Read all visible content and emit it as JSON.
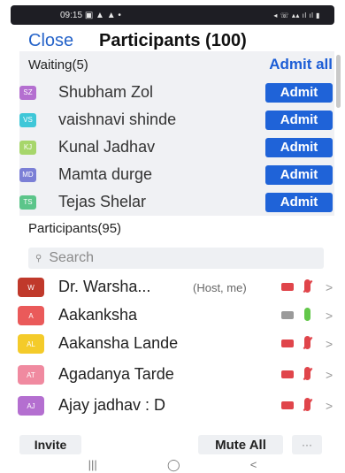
{
  "status_bar": {
    "time": "09:15",
    "left_icons": "▣ ▲ ▲ •",
    "right_icons": "◂ ☏ ▴▴ ıl ıl ▮"
  },
  "header": {
    "close_label": "Close",
    "title": "Participants (100)"
  },
  "waiting": {
    "label": "Waiting(5)",
    "admit_all_label": "Admit all",
    "rows": [
      {
        "initials": "SZ",
        "name": "Shubham Zol",
        "color": "#b46fd0",
        "admit_label": "Admit"
      },
      {
        "initials": "VS",
        "name": "vaishnavi shinde",
        "color": "#3fc7d8",
        "admit_label": "Admit"
      },
      {
        "initials": "KJ",
        "name": "Kunal Jadhav",
        "color": "#a7d66b",
        "admit_label": "Admit"
      },
      {
        "initials": "MD",
        "name": "Mamta durge",
        "color": "#7b7fd6",
        "admit_label": "Admit"
      },
      {
        "initials": "TS",
        "name": "Tejas Shelar",
        "color": "#5cc58a",
        "admit_label": "Admit"
      }
    ]
  },
  "participants": {
    "label": "Participants(95)",
    "search_placeholder": "Search",
    "rows": [
      {
        "initials": "W",
        "name": "Dr. Warsha...",
        "tag": "(Host, me)",
        "color": "#c0392b",
        "video": "off",
        "audio": "off"
      },
      {
        "initials": "A",
        "name": "Aakanksha",
        "tag": "",
        "color": "#ea5a5a",
        "video": "on",
        "audio": "on"
      },
      {
        "initials": "AL",
        "name": "Aakansha Lande",
        "tag": "",
        "color": "#f4cb2a",
        "video": "off",
        "audio": "off"
      },
      {
        "initials": "AT",
        "name": "Agadanya Tarde",
        "tag": "",
        "color": "#f08aa0",
        "video": "off",
        "audio": "off"
      },
      {
        "initials": "AJ",
        "name": "Ajay jadhav : D",
        "tag": "",
        "color": "#b46fd0",
        "video": "off",
        "audio": "off"
      }
    ]
  },
  "footer": {
    "invite_label": "Invite",
    "mute_all_label": "Mute All",
    "more_label": "···"
  },
  "nav": {
    "recents": "|||",
    "home": "◯",
    "back": "<"
  }
}
